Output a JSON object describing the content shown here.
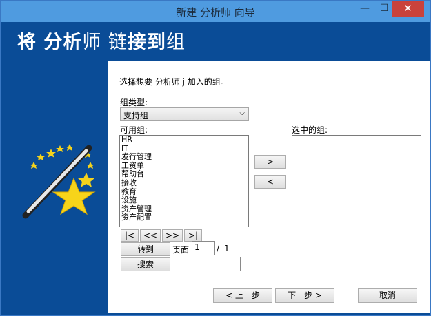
{
  "window": {
    "title": "新建 分析师 向导"
  },
  "titlebar": {
    "minimize_icon": "minimize-icon",
    "maximize_icon": "maximize-icon",
    "close_icon": "close-icon",
    "minimize_glyph": "—",
    "maximize_glyph": "☐",
    "close_glyph": "✕"
  },
  "header": {
    "part1": "将 分析",
    "part2": "师 ",
    "part3": "链",
    "part4": "接到",
    "part5": "组"
  },
  "panel": {
    "instruction": "选择想要 分析师 j 加入的组。",
    "group_type_label": "组类型:",
    "group_type_value": "支持组",
    "available_label": "可用组:",
    "selected_label": "选中的组:",
    "available_groups": [
      "HR",
      "IT",
      "发行管理",
      "工资单",
      "帮助台",
      "接收",
      "教育",
      "设施",
      "资产管理",
      "资产配置"
    ],
    "selected_groups": [],
    "add_button": ">",
    "remove_button": "<",
    "pager": {
      "first": "|<",
      "prev": "<<",
      "next": ">>",
      "last": ">|"
    },
    "goto_button": "转到",
    "page_label": "页面",
    "page_value": "1",
    "page_sep": "/",
    "page_total": "1",
    "search_button": "搜索",
    "search_value": ""
  },
  "footer": {
    "back": "< 上一步",
    "next": "下一步 >",
    "cancel": "取消"
  }
}
